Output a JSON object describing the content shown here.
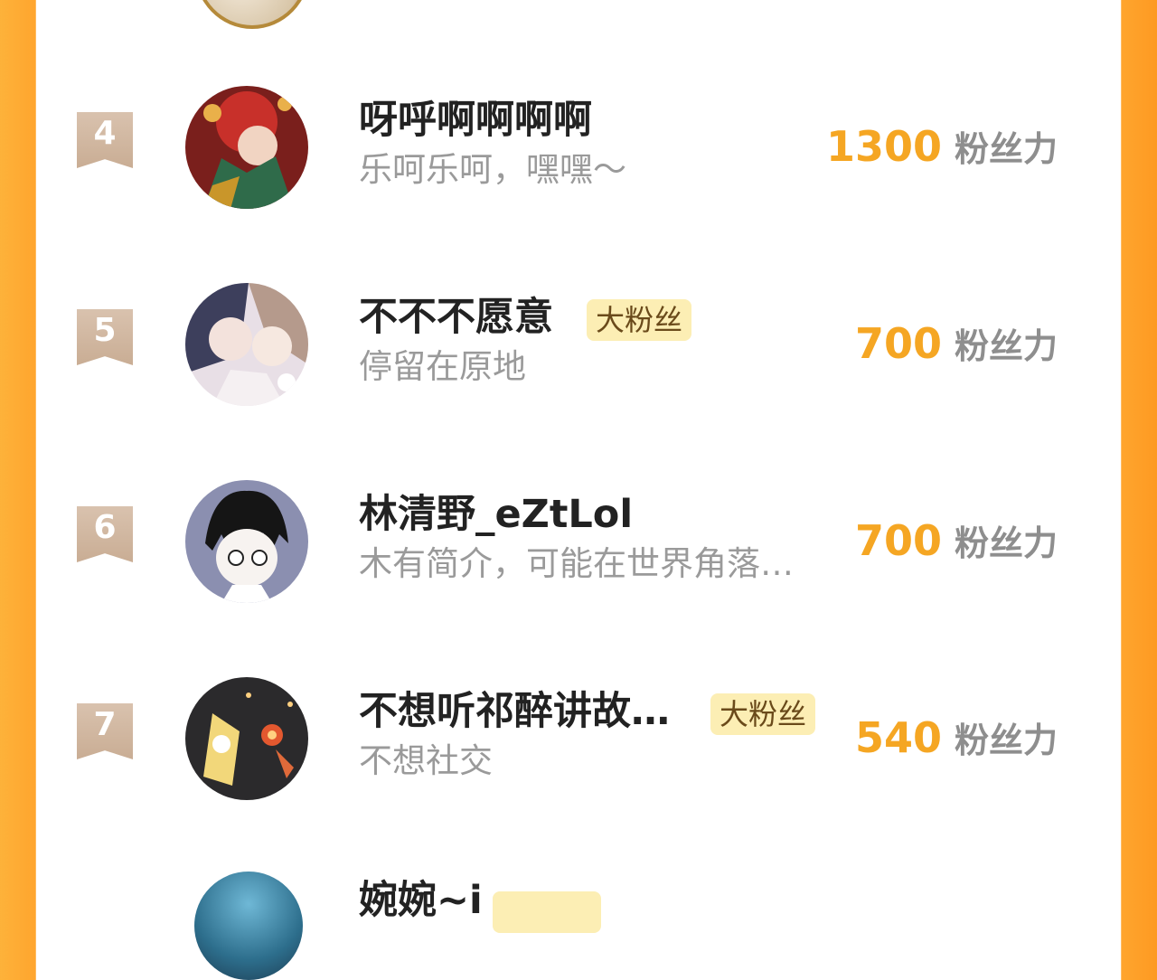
{
  "colors": {
    "accent": "#F5A623",
    "badge_bg": "#FCEEB4",
    "rank_bg": "#C9AD94",
    "side_gradient": "#FFA52E"
  },
  "score_unit": "粉丝力",
  "rows": [
    {
      "rank": "4",
      "name": "呀呼啊啊啊啊",
      "badge": "",
      "bio": "乐呵乐呵，嘿嘿～",
      "score": "1300",
      "avatar_icon": "red-costume-character-avatar"
    },
    {
      "rank": "5",
      "name": "不不不愿意",
      "badge": "大粉丝",
      "bio": "停留在原地",
      "score": "700",
      "avatar_icon": "couple-illustration-avatar"
    },
    {
      "rank": "6",
      "name": "林清野_eZtLol",
      "badge": "",
      "bio": "木有简介，可能在世界角落…",
      "score": "700",
      "avatar_icon": "chibi-boy-avatar"
    },
    {
      "rank": "7",
      "name": "不想听祁醉讲故…",
      "badge": "大粉丝",
      "bio": "不想社交",
      "score": "540",
      "avatar_icon": "dark-doodle-avatar"
    }
  ],
  "partial_next": {
    "name": "婉婉~i"
  }
}
